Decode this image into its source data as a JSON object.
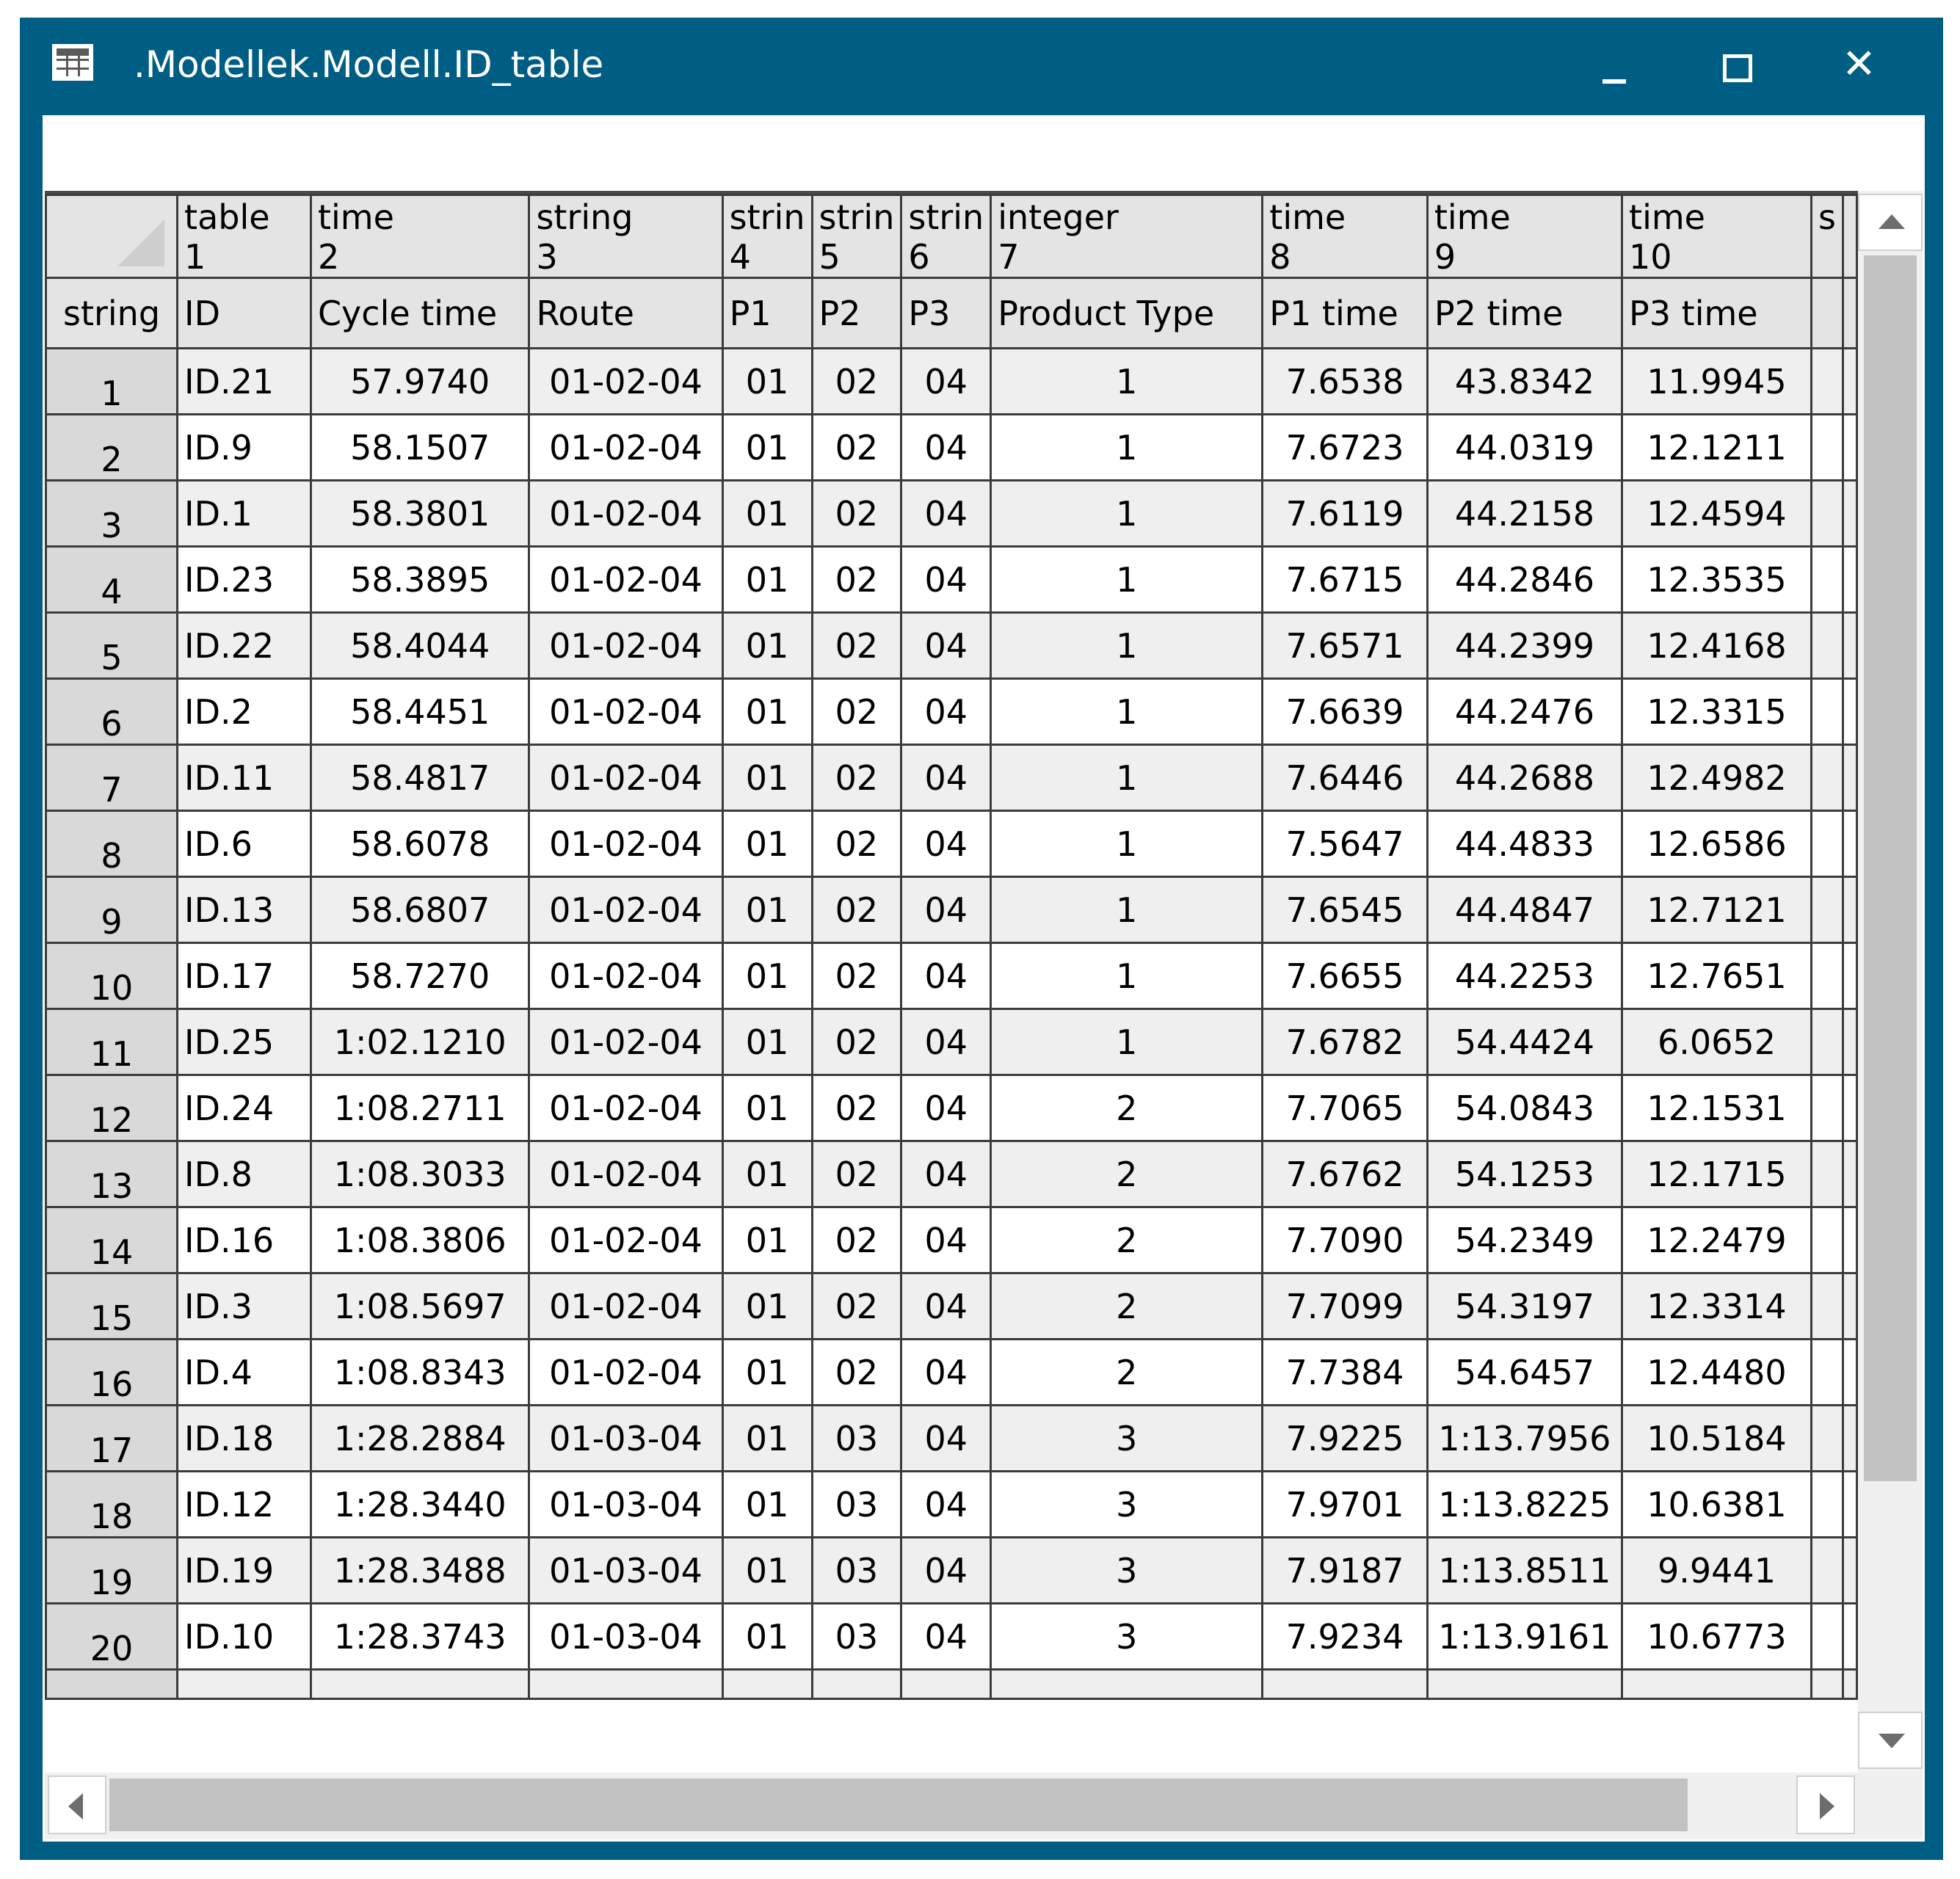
{
  "window": {
    "title": ".Modellek.Modell.ID_table",
    "title_icon": "table-icon",
    "controls": {
      "minimize_icon": "minimize-icon",
      "maximize_icon": "maximize-icon",
      "close_icon": "close-icon",
      "close_glyph": "✕"
    },
    "frame_color": "#005e84"
  },
  "formula_bar": {
    "value": ""
  },
  "table": {
    "corner_type_label": "",
    "row_header_type": "string",
    "columns": [
      {
        "type": "table",
        "index": "1",
        "name": "ID"
      },
      {
        "type": "time",
        "index": "2",
        "name": "Cycle time"
      },
      {
        "type": "string",
        "index": "3",
        "name": "Route"
      },
      {
        "type": "strin",
        "index": "4",
        "name": "P1"
      },
      {
        "type": "strin",
        "index": "5",
        "name": "P2"
      },
      {
        "type": "strin",
        "index": "6",
        "name": "P3"
      },
      {
        "type": "integer",
        "index": "7",
        "name": "Product Type"
      },
      {
        "type": "time",
        "index": "8",
        "name": "P1 time"
      },
      {
        "type": "time",
        "index": "9",
        "name": "P2 time"
      },
      {
        "type": "time",
        "index": "10",
        "name": "P3 time"
      },
      {
        "type": "s",
        "index": "",
        "name": ""
      }
    ],
    "rows": [
      {
        "row": "1",
        "cells": [
          "ID.21",
          "57.9740",
          "01-02-04",
          "01",
          "02",
          "04",
          "1",
          "7.6538",
          "43.8342",
          "11.9945"
        ]
      },
      {
        "row": "2",
        "cells": [
          "ID.9",
          "58.1507",
          "01-02-04",
          "01",
          "02",
          "04",
          "1",
          "7.6723",
          "44.0319",
          "12.1211"
        ]
      },
      {
        "row": "3",
        "cells": [
          "ID.1",
          "58.3801",
          "01-02-04",
          "01",
          "02",
          "04",
          "1",
          "7.6119",
          "44.2158",
          "12.4594"
        ]
      },
      {
        "row": "4",
        "cells": [
          "ID.23",
          "58.3895",
          "01-02-04",
          "01",
          "02",
          "04",
          "1",
          "7.6715",
          "44.2846",
          "12.3535"
        ]
      },
      {
        "row": "5",
        "cells": [
          "ID.22",
          "58.4044",
          "01-02-04",
          "01",
          "02",
          "04",
          "1",
          "7.6571",
          "44.2399",
          "12.4168"
        ]
      },
      {
        "row": "6",
        "cells": [
          "ID.2",
          "58.4451",
          "01-02-04",
          "01",
          "02",
          "04",
          "1",
          "7.6639",
          "44.2476",
          "12.3315"
        ]
      },
      {
        "row": "7",
        "cells": [
          "ID.11",
          "58.4817",
          "01-02-04",
          "01",
          "02",
          "04",
          "1",
          "7.6446",
          "44.2688",
          "12.4982"
        ]
      },
      {
        "row": "8",
        "cells": [
          "ID.6",
          "58.6078",
          "01-02-04",
          "01",
          "02",
          "04",
          "1",
          "7.5647",
          "44.4833",
          "12.6586"
        ]
      },
      {
        "row": "9",
        "cells": [
          "ID.13",
          "58.6807",
          "01-02-04",
          "01",
          "02",
          "04",
          "1",
          "7.6545",
          "44.4847",
          "12.7121"
        ]
      },
      {
        "row": "10",
        "cells": [
          "ID.17",
          "58.7270",
          "01-02-04",
          "01",
          "02",
          "04",
          "1",
          "7.6655",
          "44.2253",
          "12.7651"
        ]
      },
      {
        "row": "11",
        "cells": [
          "ID.25",
          "1:02.1210",
          "01-02-04",
          "01",
          "02",
          "04",
          "1",
          "7.6782",
          "54.4424",
          "6.0652"
        ]
      },
      {
        "row": "12",
        "cells": [
          "ID.24",
          "1:08.2711",
          "01-02-04",
          "01",
          "02",
          "04",
          "2",
          "7.7065",
          "54.0843",
          "12.1531"
        ]
      },
      {
        "row": "13",
        "cells": [
          "ID.8",
          "1:08.3033",
          "01-02-04",
          "01",
          "02",
          "04",
          "2",
          "7.6762",
          "54.1253",
          "12.1715"
        ]
      },
      {
        "row": "14",
        "cells": [
          "ID.16",
          "1:08.3806",
          "01-02-04",
          "01",
          "02",
          "04",
          "2",
          "7.7090",
          "54.2349",
          "12.2479"
        ]
      },
      {
        "row": "15",
        "cells": [
          "ID.3",
          "1:08.5697",
          "01-02-04",
          "01",
          "02",
          "04",
          "2",
          "7.7099",
          "54.3197",
          "12.3314"
        ]
      },
      {
        "row": "16",
        "cells": [
          "ID.4",
          "1:08.8343",
          "01-02-04",
          "01",
          "02",
          "04",
          "2",
          "7.7384",
          "54.6457",
          "12.4480"
        ]
      },
      {
        "row": "17",
        "cells": [
          "ID.18",
          "1:28.2884",
          "01-03-04",
          "01",
          "03",
          "04",
          "3",
          "7.9225",
          "1:13.7956",
          "10.5184"
        ]
      },
      {
        "row": "18",
        "cells": [
          "ID.12",
          "1:28.3440",
          "01-03-04",
          "01",
          "03",
          "04",
          "3",
          "7.9701",
          "1:13.8225",
          "10.6381"
        ]
      },
      {
        "row": "19",
        "cells": [
          "ID.19",
          "1:28.3488",
          "01-03-04",
          "01",
          "03",
          "04",
          "3",
          "7.9187",
          "1:13.8511",
          "9.9441"
        ]
      },
      {
        "row": "20",
        "cells": [
          "ID.10",
          "1:28.3743",
          "01-03-04",
          "01",
          "03",
          "04",
          "3",
          "7.9234",
          "1:13.9161",
          "10.6773"
        ]
      }
    ]
  },
  "scrollbars": {
    "up_icon": "scroll-up-arrow-icon",
    "down_icon": "scroll-down-arrow-icon",
    "left_icon": "scroll-left-arrow-icon",
    "right_icon": "scroll-right-arrow-icon"
  }
}
